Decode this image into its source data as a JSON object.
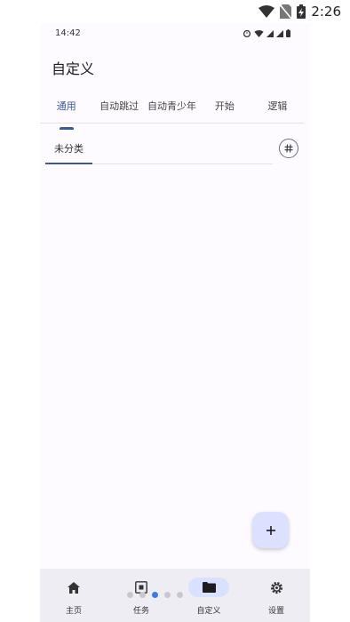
{
  "device_status": {
    "time": "2:26"
  },
  "inner_status": {
    "time": "14:42"
  },
  "page": {
    "title": "自定义"
  },
  "tabs": [
    {
      "label": "通用",
      "active": true
    },
    {
      "label": "自动跳过",
      "active": false
    },
    {
      "label": "自动青少年",
      "active": false
    },
    {
      "label": "开始",
      "active": false
    },
    {
      "label": "逻辑",
      "active": false
    }
  ],
  "subtab": {
    "label": "未分类"
  },
  "hash_button": {
    "icon": "hash-icon"
  },
  "fab": {
    "icon": "plus-icon"
  },
  "bottom_nav": [
    {
      "label": "主页",
      "icon": "home-icon",
      "active": false
    },
    {
      "label": "任务",
      "icon": "expand-icon",
      "active": false
    },
    {
      "label": "自定义",
      "icon": "folder-icon",
      "active": true
    },
    {
      "label": "设置",
      "icon": "gear-icon",
      "active": false
    }
  ],
  "page_indicator": {
    "count": 5,
    "current": 2
  },
  "colors": {
    "accent": "#3d5a98",
    "fab_bg": "#dbe1ff",
    "nav_bg": "#eeedf4"
  }
}
